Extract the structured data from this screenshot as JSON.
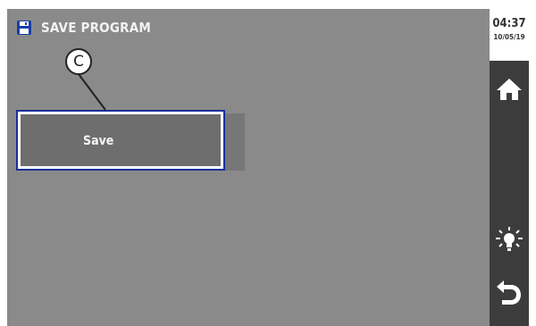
{
  "header": {
    "title": "SAVE PROGRAM",
    "icon": "floppy-disk-icon"
  },
  "clock": {
    "time": "04:37",
    "date": "10/05/19"
  },
  "main": {
    "save_label": "Save",
    "callout_label": "C"
  },
  "sidebar": {
    "items": [
      "home-icon",
      "lightbulb-icon",
      "back-arrow-icon"
    ]
  },
  "colors": {
    "background": "#8a8a8a",
    "sidebar": "#3c3c3c",
    "accent": "#1a2e9c"
  }
}
